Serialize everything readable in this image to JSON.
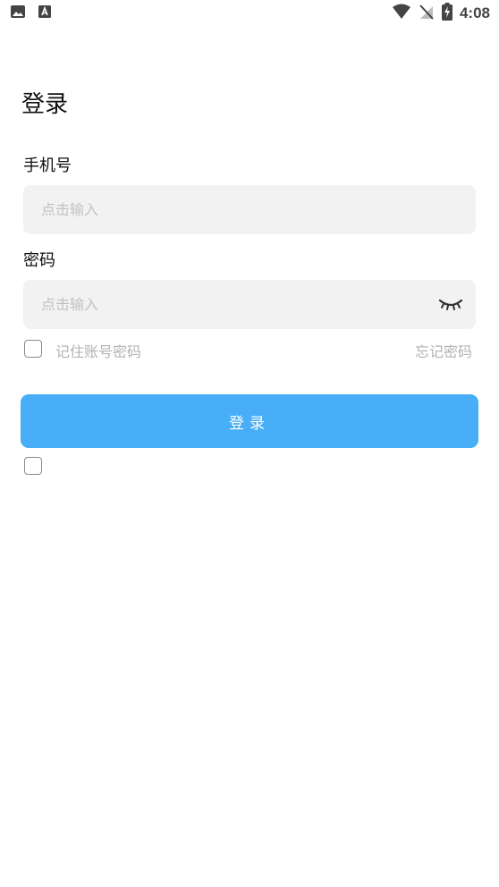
{
  "status_bar": {
    "time": "4:08",
    "left_icons": [
      "image-icon",
      "a-icon"
    ],
    "right_icons": [
      "wifi-icon",
      "signal-off-icon",
      "battery-charging-icon"
    ]
  },
  "title": "登录",
  "phone": {
    "label": "手机号",
    "placeholder": "点击输入",
    "value": ""
  },
  "password": {
    "label": "密码",
    "placeholder": "点击输入",
    "value": "",
    "toggle_icon": "eye-closed-icon"
  },
  "remember": {
    "label": "记住账号密码",
    "checked": false
  },
  "forgot": {
    "label": "忘记密码"
  },
  "login_button": {
    "label": "登录"
  },
  "colors": {
    "accent": "#48aef8",
    "field_bg": "#f2f2f2",
    "placeholder": "#c2c2c2",
    "muted_text": "#b3b3b3"
  }
}
